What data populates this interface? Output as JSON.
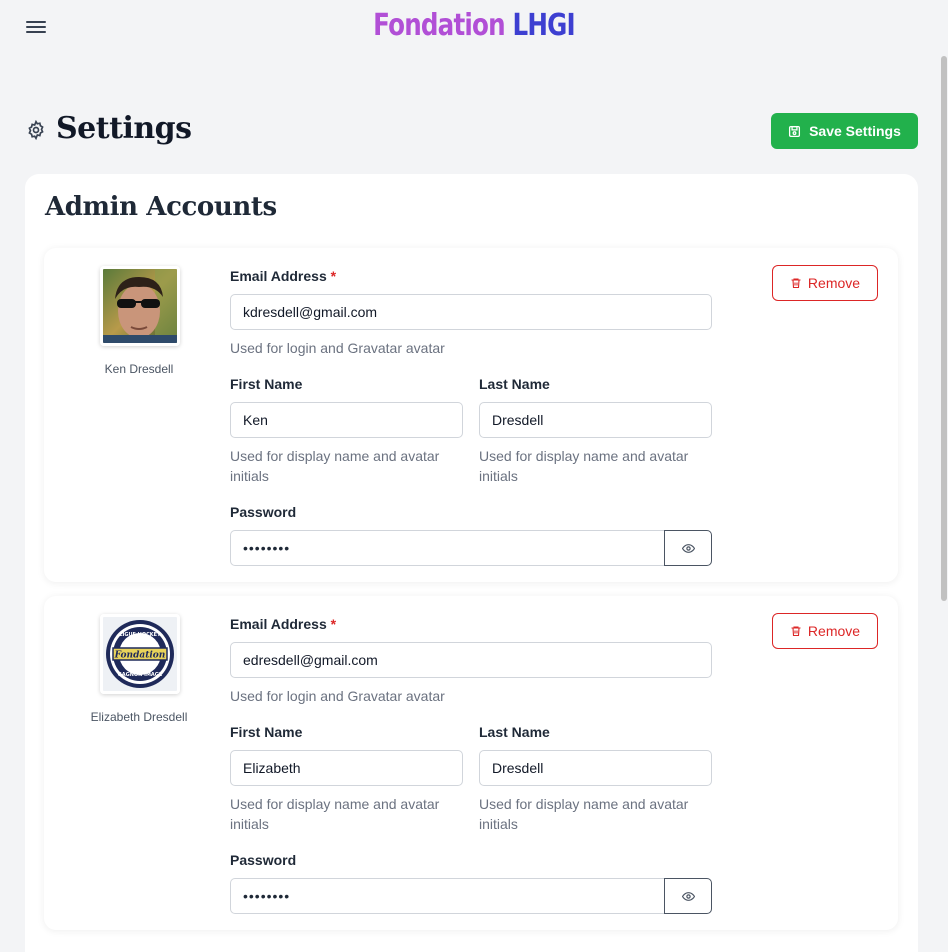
{
  "brand": {
    "part1": "Fondation ",
    "part2": "LHGI"
  },
  "page": {
    "title": "Settings",
    "save_label": "Save Settings"
  },
  "section": {
    "title": "Admin Accounts"
  },
  "labels": {
    "email": "Email Address",
    "required_mark": "*",
    "first_name": "First Name",
    "last_name": "Last Name",
    "password": "Password",
    "remove": "Remove"
  },
  "help": {
    "email": "Used for login and Gravatar avatar",
    "first_name": "Used for display name and avatar initials",
    "last_name": "Used for display name and avatar initials"
  },
  "accounts": [
    {
      "display_name": "Ken Dresdell",
      "email": "kdresdell@gmail.com",
      "first_name": "Ken",
      "last_name": "Dresdell",
      "password_mask": "••••••••"
    },
    {
      "display_name": "Elizabeth Dresdell",
      "email": "edresdell@gmail.com",
      "first_name": "Elizabeth",
      "last_name": "Dresdell",
      "password_mask": "••••••••",
      "logo_text": {
        "top": "LIGUE HOCKEY",
        "middle": "Fondation",
        "bottom": "GAGNON IMAGE"
      }
    }
  ],
  "colors": {
    "accent_green": "#22b14c",
    "danger": "#dc2626",
    "brand_purple": "#b14fd6",
    "brand_blue": "#3d3fd1"
  },
  "icons": {
    "menu": "hamburger-icon",
    "settings": "gear-icon",
    "save": "floppy-disk-icon",
    "remove": "trash-icon",
    "reveal": "eye-icon"
  }
}
